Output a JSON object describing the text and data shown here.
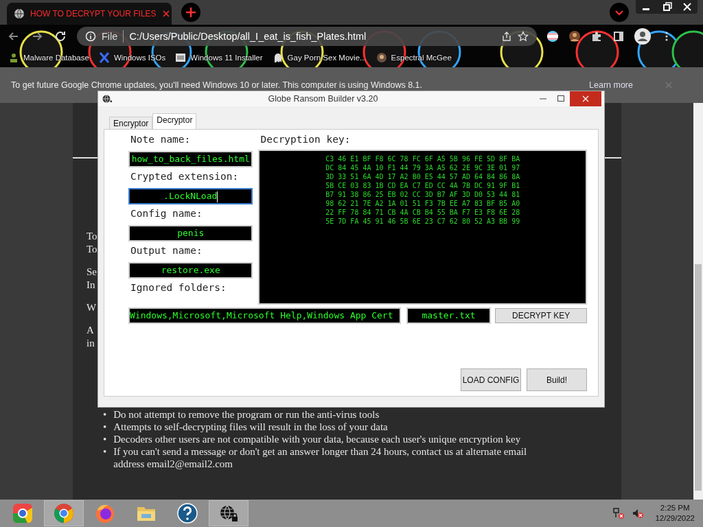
{
  "browser": {
    "tab": {
      "title": "HOW TO DECRYPT YOUR FILES"
    },
    "address": {
      "scheme": "File",
      "url": "C:/Users/Public/Desktop/all_I_eat_is_fish_Plates.html"
    },
    "bookmarks": [
      {
        "kind": "person",
        "label": "Malware Database"
      },
      {
        "kind": "x",
        "label": "Windows ISOs"
      },
      {
        "kind": "image",
        "label": "Windows 11 Installer"
      },
      {
        "kind": "ghost",
        "label": "Gay Porn Sex Movie..."
      },
      {
        "kind": "avatar",
        "label": "Espectral McGee"
      }
    ],
    "infobar": {
      "message": "To get future Google Chrome updates, you'll need Windows 10 or later. This computer is using Windows 8.1.",
      "link": "Learn more"
    }
  },
  "page": {
    "partial_paragraphs": [
      [
        "To",
        "To"
      ],
      [
        "Se",
        "In"
      ],
      [
        "W"
      ],
      [
        "A",
        "in"
      ]
    ],
    "bullets": [
      {
        "marker": "•",
        "text": "Do not attempt to remove the program or run the anti-virus tools"
      },
      {
        "marker": "•",
        "text": "Attempts to self-decrypting files will result in the loss of your data"
      },
      {
        "marker": "•",
        "text": "Decoders other users are not compatible with your data, because each user's unique encryption key"
      },
      {
        "marker": "•",
        "text": "If you can't send a message or don't get an answer longer than 24 hours, contact us at alternate email address email2@email2.com"
      }
    ]
  },
  "dialog": {
    "title": "Globe Ransom Builder v3.20",
    "tabs": [
      {
        "label": "Encryptor",
        "selected": false
      },
      {
        "label": "Decryptor",
        "selected": true
      }
    ],
    "fields": [
      {
        "label": "Note name:",
        "value": "how_to_back_files.html",
        "focused": false
      },
      {
        "label": "Crypted extension:",
        "value": ".LockNLoad",
        "focused": true
      },
      {
        "label": "Config name:",
        "value": "penis",
        "focused": false
      },
      {
        "label": "Output name:",
        "value": "restore.exe",
        "focused": false
      }
    ],
    "decryption_key": {
      "label": "Decryption key:",
      "lines": [
        "C3 46 E1 BF F8 6C 78 FC 6F A5 5B 96 FE 5D 8F BA",
        "DC 84 45 4A 10 F1 44 79 3A A5 62 2E 9C 3E 01 97",
        "3D 33 51 6A 4D 17 A2 B0 E5 44 57 AD 64 84 86 8A",
        "5B CE 03 83 1B CD EA C7 ED CC 4A 7B DC 91 9F B1",
        "B7 91 38 86 25 EB 02 CC 3D B7 AF 3D D0 53 44 81",
        "98 62 21 7E A2 1A 01 51 F3 7B EE A7 83 BF B5 A0",
        "22 FF 78 84 71 CB 4A CB B4 55 BA F7 E3 F8 6E 28",
        "5E 7D FA 45 91 46 5B 6E 23 C7 62 80 52 A3 BB 99"
      ]
    },
    "ignored_folders": {
      "label": "Ignored folders:",
      "value": "Windows,Microsoft,Microsoft Help,Windows App Cert"
    },
    "key_file": "master.txt",
    "decrypt_button": "DECRYPT KEY",
    "buttons": [
      "LOAD CONFIG",
      "Build!"
    ]
  },
  "taskbar": {
    "apps": [
      {
        "kind": "chrome-old",
        "active": false
      },
      {
        "kind": "chrome",
        "active": true
      },
      {
        "kind": "firefox",
        "active": false
      },
      {
        "kind": "explorer",
        "active": false
      },
      {
        "kind": "help",
        "active": false
      },
      {
        "kind": "globe-lock",
        "active": true
      }
    ],
    "time": "2:25 PM",
    "date": "12/29/2022"
  }
}
